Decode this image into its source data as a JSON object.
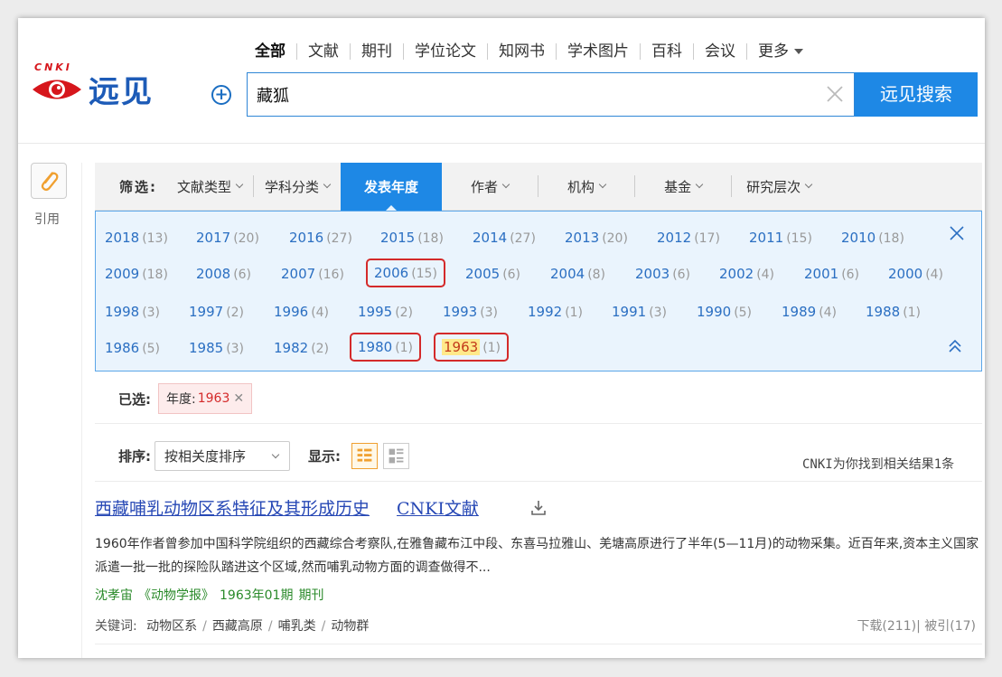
{
  "logo": {
    "letters": "CNKI",
    "text": "远见"
  },
  "tabs": [
    "全部",
    "文献",
    "期刊",
    "学位论文",
    "知网书",
    "学术图片",
    "百科",
    "会议",
    "更多"
  ],
  "search": {
    "value": "藏狐",
    "button": "远见搜索"
  },
  "sidebar": {
    "cite_label": "引用"
  },
  "filter": {
    "label": "筛选:",
    "items": [
      "文献类型",
      "学科分类",
      "发表年度",
      "作者",
      "机构",
      "基金",
      "研究层次"
    ],
    "active": "发表年度"
  },
  "years": [
    [
      {
        "y": "2018",
        "c": "(13)"
      },
      {
        "y": "2017",
        "c": "(20)"
      },
      {
        "y": "2016",
        "c": "(27)"
      },
      {
        "y": "2015",
        "c": "(18)"
      },
      {
        "y": "2014",
        "c": "(27)"
      },
      {
        "y": "2013",
        "c": "(20)"
      },
      {
        "y": "2012",
        "c": "(17)"
      },
      {
        "y": "2011",
        "c": "(15)"
      },
      {
        "y": "2010",
        "c": "(18)"
      }
    ],
    [
      {
        "y": "2009",
        "c": "(18)"
      },
      {
        "y": "2008",
        "c": "(6)"
      },
      {
        "y": "2007",
        "c": "(16)"
      },
      {
        "y": "2006",
        "c": "(15)"
      },
      {
        "y": "2005",
        "c": "(6)"
      },
      {
        "y": "2004",
        "c": "(8)"
      },
      {
        "y": "2003",
        "c": "(6)"
      },
      {
        "y": "2002",
        "c": "(4)"
      },
      {
        "y": "2001",
        "c": "(6)"
      },
      {
        "y": "2000",
        "c": "(4)"
      }
    ],
    [
      {
        "y": "1998",
        "c": "(3)"
      },
      {
        "y": "1997",
        "c": "(2)"
      },
      {
        "y": "1996",
        "c": "(4)"
      },
      {
        "y": "1995",
        "c": "(2)"
      },
      {
        "y": "1993",
        "c": "(3)"
      },
      {
        "y": "1992",
        "c": "(1)"
      },
      {
        "y": "1991",
        "c": "(3)"
      },
      {
        "y": "1990",
        "c": "(5)"
      },
      {
        "y": "1989",
        "c": "(4)"
      },
      {
        "y": "1988",
        "c": "(1)"
      }
    ],
    [
      {
        "y": "1986",
        "c": "(5)"
      },
      {
        "y": "1985",
        "c": "(3)"
      },
      {
        "y": "1982",
        "c": "(2)"
      },
      {
        "y": "1980",
        "c": "(1)"
      },
      {
        "y": "1963",
        "c": "(1)"
      }
    ]
  ],
  "highlighted_years": [
    "2006",
    "1980",
    "1963"
  ],
  "selected_year": "1963",
  "selected": {
    "label": "已选:",
    "tag_key": "年度:",
    "tag_value": "1963"
  },
  "sort": {
    "label": "排序:",
    "value": "按相关度排序",
    "display_label": "显示:"
  },
  "result_count": "CNKI为你找到相关结果1条",
  "result": {
    "title": "西藏哺乳动物区系特征及其形成历史",
    "source_link": "CNKI文献",
    "abstract": "1960年作者曾参加中国科学院组织的西藏综合考察队,在雅鲁藏布江中段、东喜马拉雅山、羌塘高原进行了半年(5—11月)的动物采集。近百年来,资本主义国家派遣一批一批的探险队踏进这个区域,然而哺乳动物方面的调查做得不...",
    "author": "沈孝宙",
    "journal": "《动物学报》",
    "issue": "1963年01期",
    "type": "期刊",
    "keywords_label": "关键词:",
    "keywords": [
      "动物区系",
      "西藏高原",
      "哺乳类",
      "动物群"
    ],
    "stats": "下载(211)| 被引(17)"
  },
  "colors": {
    "accent": "#1e88e5",
    "link": "#2b6fc2",
    "highlight_border": "#d42a2a",
    "meta_green": "#2a8a2a"
  }
}
